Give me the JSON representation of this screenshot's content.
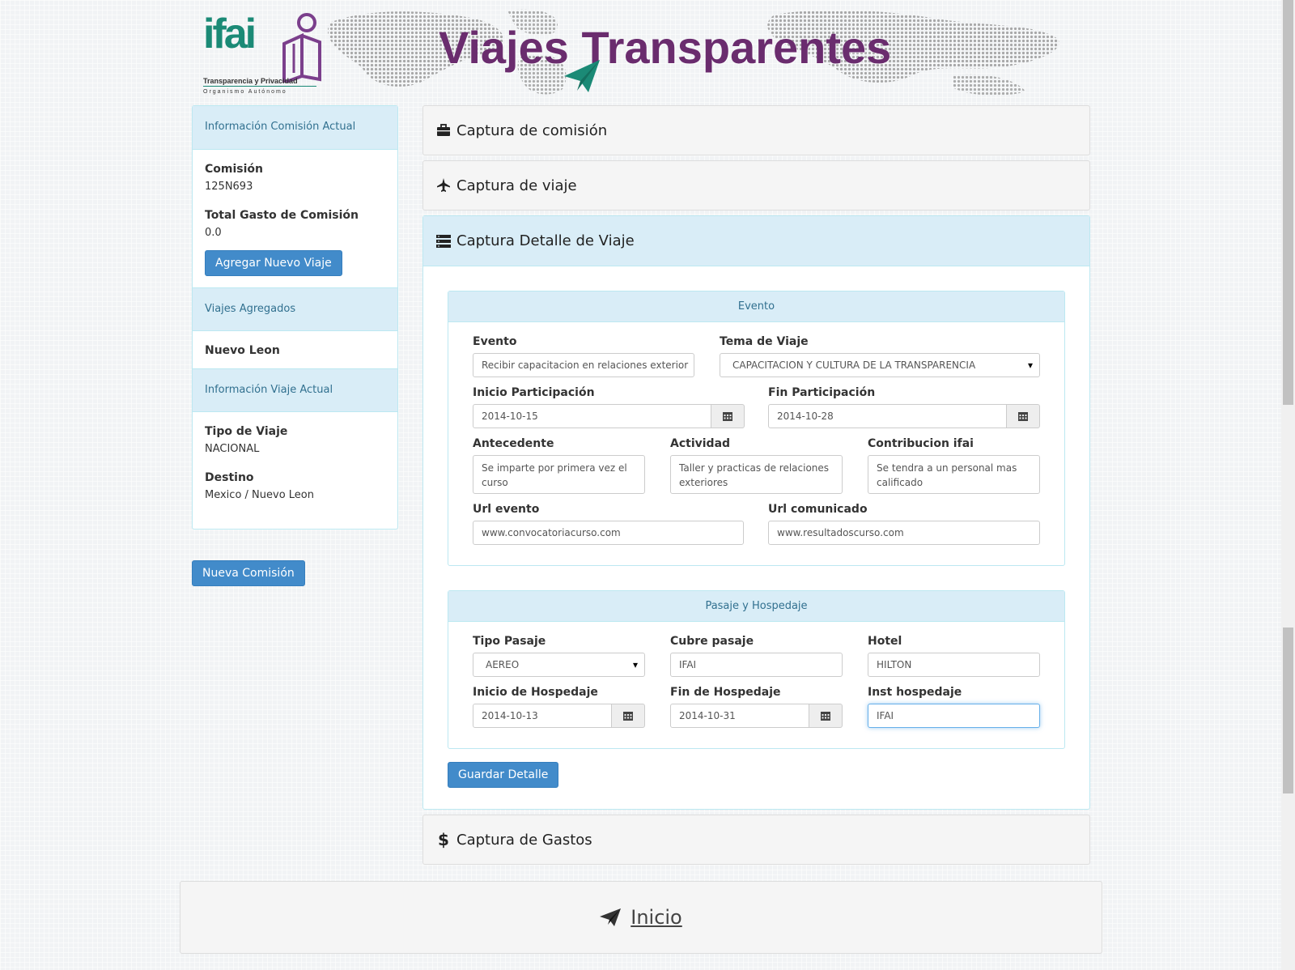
{
  "header": {
    "logo_word": "ifai",
    "logo_sub": "Transparencia y Privacidad",
    "logo_org": "Organismo Autónomo",
    "site_title": "Viajes Transparentes"
  },
  "sidebar": {
    "section1_title": "Información Comisión Actual",
    "comision_label": "Comisión",
    "comision_value": "125N693",
    "total_label": "Total Gasto de Comisión",
    "total_value": "0.0",
    "add_trip_button": "Agregar Nuevo Viaje",
    "section2_title": "Viajes Agregados",
    "trips": [
      "Nuevo Leon"
    ],
    "section3_title": "Información Viaje Actual",
    "tipo_label": "Tipo de Viaje",
    "tipo_value": "NACIONAL",
    "destino_label": "Destino",
    "destino_value": "Mexico / Nuevo Leon",
    "new_commission_button": "Nueva Comisión"
  },
  "accordion": {
    "panel1": {
      "title": "Captura de comisión",
      "icon": "briefcase-icon"
    },
    "panel2": {
      "title": "Captura de viaje",
      "icon": "plane-icon"
    },
    "panel3": {
      "title": "Captura Detalle de Viaje",
      "icon": "list-icon"
    },
    "panel4": {
      "title": "Captura de Gastos",
      "icon": "dollar-icon"
    }
  },
  "evento": {
    "title": "Evento",
    "evento_label": "Evento",
    "evento_value": "Recibir capacitacion en relaciones exterior",
    "tema_label": "Tema de Viaje",
    "tema_value": "CAPACITACION Y CULTURA DE LA TRANSPARENCIA",
    "inicio_label": "Inicio Participación",
    "inicio_value": "2014-10-15",
    "fin_label": "Fin Participación",
    "fin_value": "2014-10-28",
    "antecedente_label": "Antecedente",
    "antecedente_value": "Se imparte por primera vez el curso",
    "actividad_label": "Actividad",
    "actividad_value": "Taller y practicas de relaciones exteriores",
    "contribucion_label": "Contribucion ifai",
    "contribucion_value": "Se tendra a un personal mas calificado",
    "url_evento_label": "Url evento",
    "url_evento_value": "www.convocatoriacurso.com",
    "url_comunicado_label": "Url comunicado",
    "url_comunicado_value": "www.resultadoscurso.com"
  },
  "pasaje": {
    "title": "Pasaje y Hospedaje",
    "tipo_label": "Tipo Pasaje",
    "tipo_value": "AEREO",
    "cubre_label": "Cubre pasaje",
    "cubre_value": "IFAI",
    "hotel_label": "Hotel",
    "hotel_value": "HILTON",
    "inicio_label": "Inicio de Hospedaje",
    "inicio_value": "2014-10-13",
    "fin_label": "Fin de Hospedaje",
    "fin_value": "2014-10-31",
    "inst_label": "Inst hospedaje",
    "inst_value": "IFAI"
  },
  "save_button": "Guardar Detalle",
  "footer": {
    "link": "Inicio",
    "icon": "paper-plane-icon"
  }
}
